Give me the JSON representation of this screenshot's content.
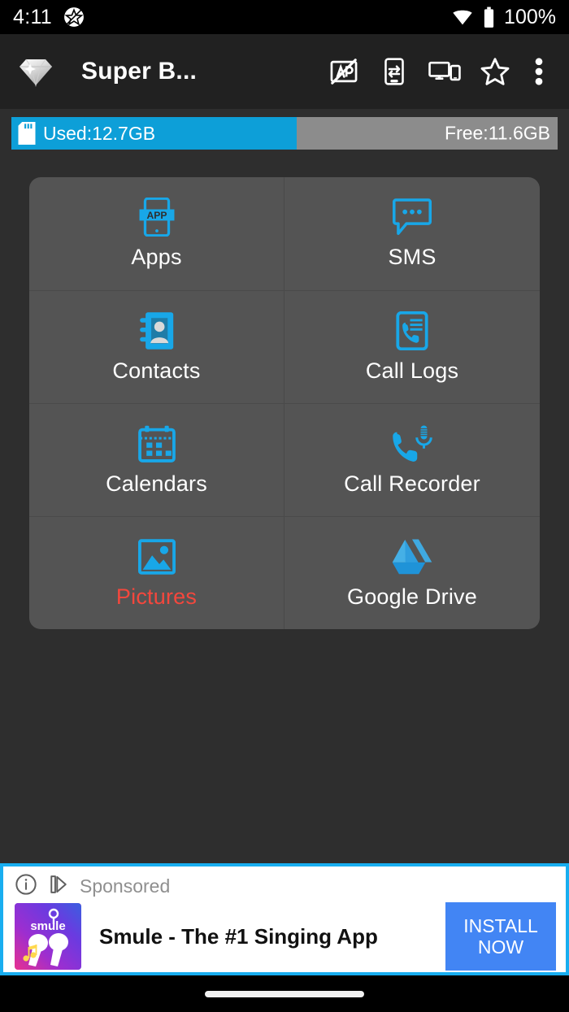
{
  "status_bar": {
    "time": "4:11",
    "app_notification_icon": "star-badge-icon",
    "wifi_icon": "wifi-icon",
    "battery_icon": "battery-full-icon",
    "battery_percent": "100%"
  },
  "app_bar": {
    "logo_icon": "diamond-icon",
    "title": "Super B...",
    "actions": [
      {
        "name": "ad-block-icon",
        "label": "Remove Ads"
      },
      {
        "name": "phone-transfer-icon",
        "label": "Phone Transfer"
      },
      {
        "name": "pc-mobile-icon",
        "label": "PC Connect"
      },
      {
        "name": "star-icon",
        "label": "Rate"
      },
      {
        "name": "overflow-menu-icon",
        "label": "More options"
      }
    ]
  },
  "storage": {
    "card_icon": "sd-card-icon",
    "used_label": "Used:12.7GB",
    "free_label": "Free:11.6GB",
    "used_percent": 52.3,
    "used_color": "#0d9fd8",
    "free_color": "#8c8c8c"
  },
  "grid": {
    "accent_color": "#18a7e8",
    "highlight_color": "#f4473d",
    "items": [
      {
        "label": "Apps",
        "icon": "apps-phone-icon",
        "highlighted": false
      },
      {
        "label": "SMS",
        "icon": "sms-bubble-icon",
        "highlighted": false
      },
      {
        "label": "Contacts",
        "icon": "contacts-book-icon",
        "highlighted": false
      },
      {
        "label": "Call Logs",
        "icon": "call-logs-icon",
        "highlighted": false
      },
      {
        "label": "Calendars",
        "icon": "calendar-icon",
        "highlighted": false
      },
      {
        "label": "Call Recorder",
        "icon": "call-recorder-icon",
        "highlighted": false
      },
      {
        "label": "Pictures",
        "icon": "pictures-image-icon",
        "highlighted": true
      },
      {
        "label": "Google Drive",
        "icon": "google-drive-icon",
        "highlighted": false
      }
    ]
  },
  "ad": {
    "info_icon": "info-circle-icon",
    "adchoices_icon": "adchoices-icon",
    "sponsored_label": "Sponsored",
    "app_icon": "smule-app-icon",
    "app_icon_text": "smule",
    "title": "Smule - The #1 Singing App",
    "cta_line1": "INSTALL",
    "cta_line2": "NOW",
    "cta_color": "#4285f4",
    "border_color": "#18aef0"
  },
  "nav_bar": {
    "gesture_pill": "home-gesture-pill"
  }
}
